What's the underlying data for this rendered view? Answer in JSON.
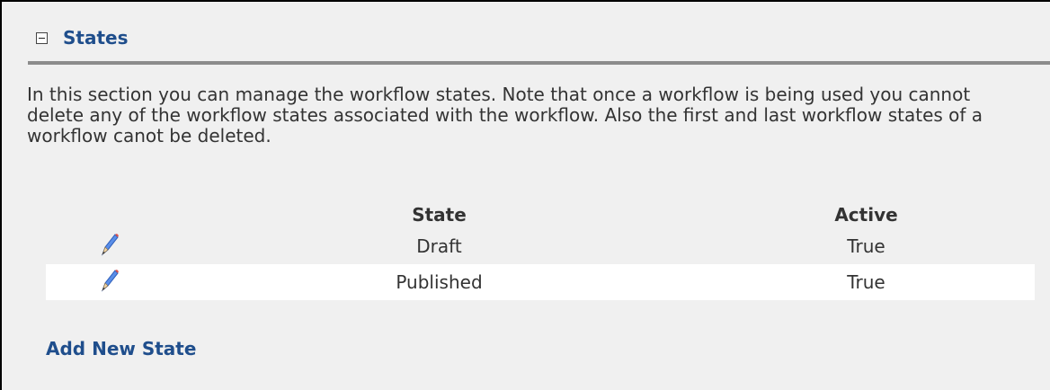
{
  "section": {
    "title": "States",
    "description": "In this section you can manage the workflow states. Note that once a workflow is being used you cannot delete any of the workflow states associated with the workflow. Also the first and last workflow states of a workflow canot be deleted."
  },
  "table": {
    "columns": [
      "State",
      "Active"
    ],
    "rows": [
      {
        "state": "Draft",
        "active": "True"
      },
      {
        "state": "Published",
        "active": "True"
      }
    ]
  },
  "actions": {
    "add_new_state": "Add New State"
  },
  "icons": {
    "collapse": "minus-box-icon",
    "edit": "pencil-icon"
  },
  "colors": {
    "title": "#1f4e8c",
    "panel_background": "#f0f0f0",
    "divider": "#8c8c8c"
  }
}
